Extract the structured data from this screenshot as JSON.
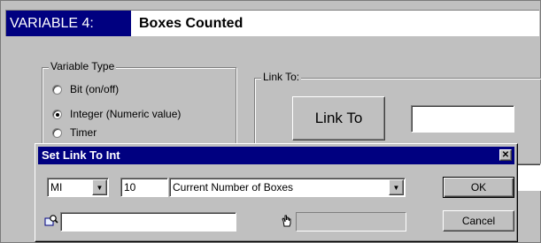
{
  "header": {
    "tag": "VARIABLE 4:",
    "name": "Boxes Counted"
  },
  "variable_type": {
    "legend": "Variable Type",
    "options": [
      {
        "label": "Bit (on/off)",
        "selected": false
      },
      {
        "label": "Integer (Numeric value)",
        "selected": true
      },
      {
        "label": "Timer",
        "selected": false
      }
    ]
  },
  "link_to": {
    "legend": "Link To:",
    "button_label": "Link To",
    "field_value": ""
  },
  "dialog": {
    "title": "Set Link To Int",
    "close_glyph": "✕",
    "type_select": "MI",
    "address_value": "10",
    "description_select": "Current Number of Boxes",
    "ok_label": "OK",
    "cancel_label": "Cancel",
    "search_value": "",
    "pointer_value": "",
    "icons": [
      "search-icon",
      "hand-pointer-icon"
    ]
  }
}
